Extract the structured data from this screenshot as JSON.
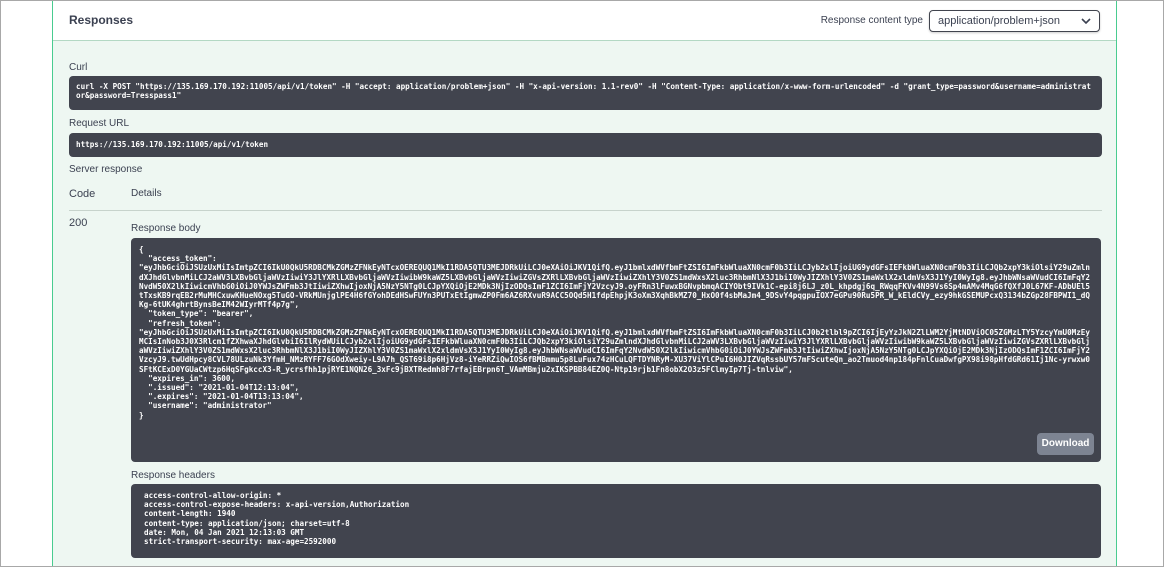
{
  "responses": {
    "title": "Responses",
    "content_type_label": "Response content type",
    "content_type_value": "application/problem+json"
  },
  "curl": {
    "label": "Curl",
    "command": "curl -X POST \"https://135.169.170.192:11005/api/v1/token\" -H \"accept: application/problem+json\" -H \"x-api-version: 1.1-rev0\" -H \"Content-Type: application/x-www-form-urlencoded\" -d \"grant_type=password&username=administrator&password=Tresspass1\""
  },
  "request_url": {
    "label": "Request URL",
    "value": "https://135.169.170.192:11005/api/v1/token"
  },
  "server_response": {
    "label": "Server response",
    "col_code": "Code",
    "col_details": "Details",
    "status_code": "200",
    "body_label": "Response body",
    "body": "{\n  \"access_token\":\n\"eyJhbGciOiJSUzUxMiIsImtpZCI6IkU0QkU5RDBCMkZGMzZFNkEyNTcxOEREQUQ1MkI1RDA5QTU3MEJDRkUiLCJ0eXAiOiJKV1QifQ.eyJ1bmlxdWVfbmFtZSI6ImFkbWluaXN0cmF0b3IiLCJyb2xlIjoiUG9ydGFsIEFkbWluaXN0cmF0b3IiLCJQb2xpY3kiOlsiY29uZmlndXJhdGlvbnMiLCJ2aWV3LXBvbGljaWVzIiwiY3JlYXRlLXBvbGljaWVzIiwibW9kaWZ5LXBvbGljaWVzIiwiZGVsZXRlLXBvbGljaWVzIiwiZXhlY3V0ZS1mdWxsX2luc3RhbmNlX3J1biI0WyJIZXhlY3V0ZS1maWxlX2xldmVsX3J1YyI0WyIg8.eyJhbWNsaWVudCI6ImFqY2NvdW50X2lkIiwicmVhbG0iOiJ0YWJsZWFmb3JtIiwiZXhwIjoxNjA5NzY5NTg0LCJpYXQiOjE2MDk3NjIzODQsImF1ZCI6ImFjY2VzcyJ9.oyFRn3lFuwxBGNvpbmqACIYObt9IVk1C-epi8j6LJ_z0L_khpdgj6q_RWqqFKVv4N99Vs6Sp4mAMv4MqG6fQXfJ0L67KF-ADbUEl5tTxsKB9rqEB2rMuMHCxuwKHueNOxg5TuGO-VRkMUnjglPE4H6fGYohDEdHSwFUYn3PUTxEtIgmwZP0Fm6AZ6RXvuR9ACC5OQd5H1fdpEhpjK3oXm3XqhBkMZ70_HxO0f4sbMaJm4_9DSvY4pqgpuIOX7eGPu90Ru5PR_W_kEldCVy_ezy9hkGSEMUPcxQ3134bZGp28FBPWI1_dQKg-6tUK4ghrtBynsBeIM42WIyrMTf4p7g\",\n  \"token_type\": \"bearer\",\n  \"refresh_token\":\n\"eyJhbGciOiJSUzUxMiIsImtpZCI6IkU0QkU5RDBCMkZGMzZFNkEyNTcxOEREQUQ1MkI1RDA5QTU3MEJDRkUiLCJ0eXAiOiJKV1QifQ.eyJ1bmlxdWVfbmFtZSI6ImFkbWluaXN0cmF0b3IiLCJ0b2tlbl9pZCI6IjEyYzJkN2ZlLWM2YjMtNDViOC05ZGMzLTY5YzcyYmU0MzEyMCIsInNob3J0X3Rlcm1fZXhwaXJhdGlvbiI6IlRydWUiLCJyb2xlIjoiUG9ydGFsIEFkbWluaXN0cmF0b3IiLCJQb2xpY3kiOlsiY29uZmlndXJhdGlvbnMiLCJ2aWV3LXBvbGljaWVzIiwiY3JlYXRlLXBvbGljaWVzIiwibW9kaWZ5LXBvbGljaWVzIiwiZGVsZXRlLXBvbGljaWVzIiwiZXhlY3V0ZS1mdWxsX2luc3RhbmNlX3J1biI0WyJIZXhlY3V0ZS1maWxlX2xldmVsX3J1YyI0WyIg8.eyJhbWNsaWVudCI6ImFqY2NvdW50X2lkIiwicmVhbG0iOiJ0YWJsZWFmb3JtIiwiZXhwIjoxNjA5NzY5NTg0LCJpYXQiOjE2MDk3NjIzODQsImF1ZCI6ImFjY2VzcyJ9.twUdHpcy8CVL78ULzuNk3YfmH_NMzRYFF76GOdXweiy-L9A7h_QST69i8p6HjVz8-iYeRRZiQwIOS6fBMBmmu5p8LuFux74zHCuLQFTDYNRyM-XU37ViYlCPuI6H0JIZVqRssbUY57mFScuteQn_ao2Tmuod4np184pFnlCuaDwfgPX98i98pHfdGRd61Ij1Nc-yrwxw0SFtKCExD0YGUaCWtzp6HqSFgkccX3-R_ycrsfhh1pjRYE1NQN26_3xFc9jBXTRedmh8F7rfajEBrpn6T_VAmMBmju2xIKSPBB84EZ0Q-Ntp19rjb1Fn8obX2O3z5FClmyIp7Tj-tnlviw\",\n  \"expires_in\": 3600,\n  \".issued\": \"2021-01-04T12:13:04\",\n  \".expires\": \"2021-01-04T13:13:04\",\n  \"username\": \"administrator\"\n}",
    "download_label": "Download",
    "headers_label": "Response headers",
    "headers": "access-control-allow-origin: *\naccess-control-expose-headers: x-api-version,Authorization\ncontent-length: 1940\ncontent-type: application/json; charset=utf-8\ndate: Mon, 04 Jan 2021 12:13:03 GMT\nstrict-transport-security: max-age=2592000"
  }
}
